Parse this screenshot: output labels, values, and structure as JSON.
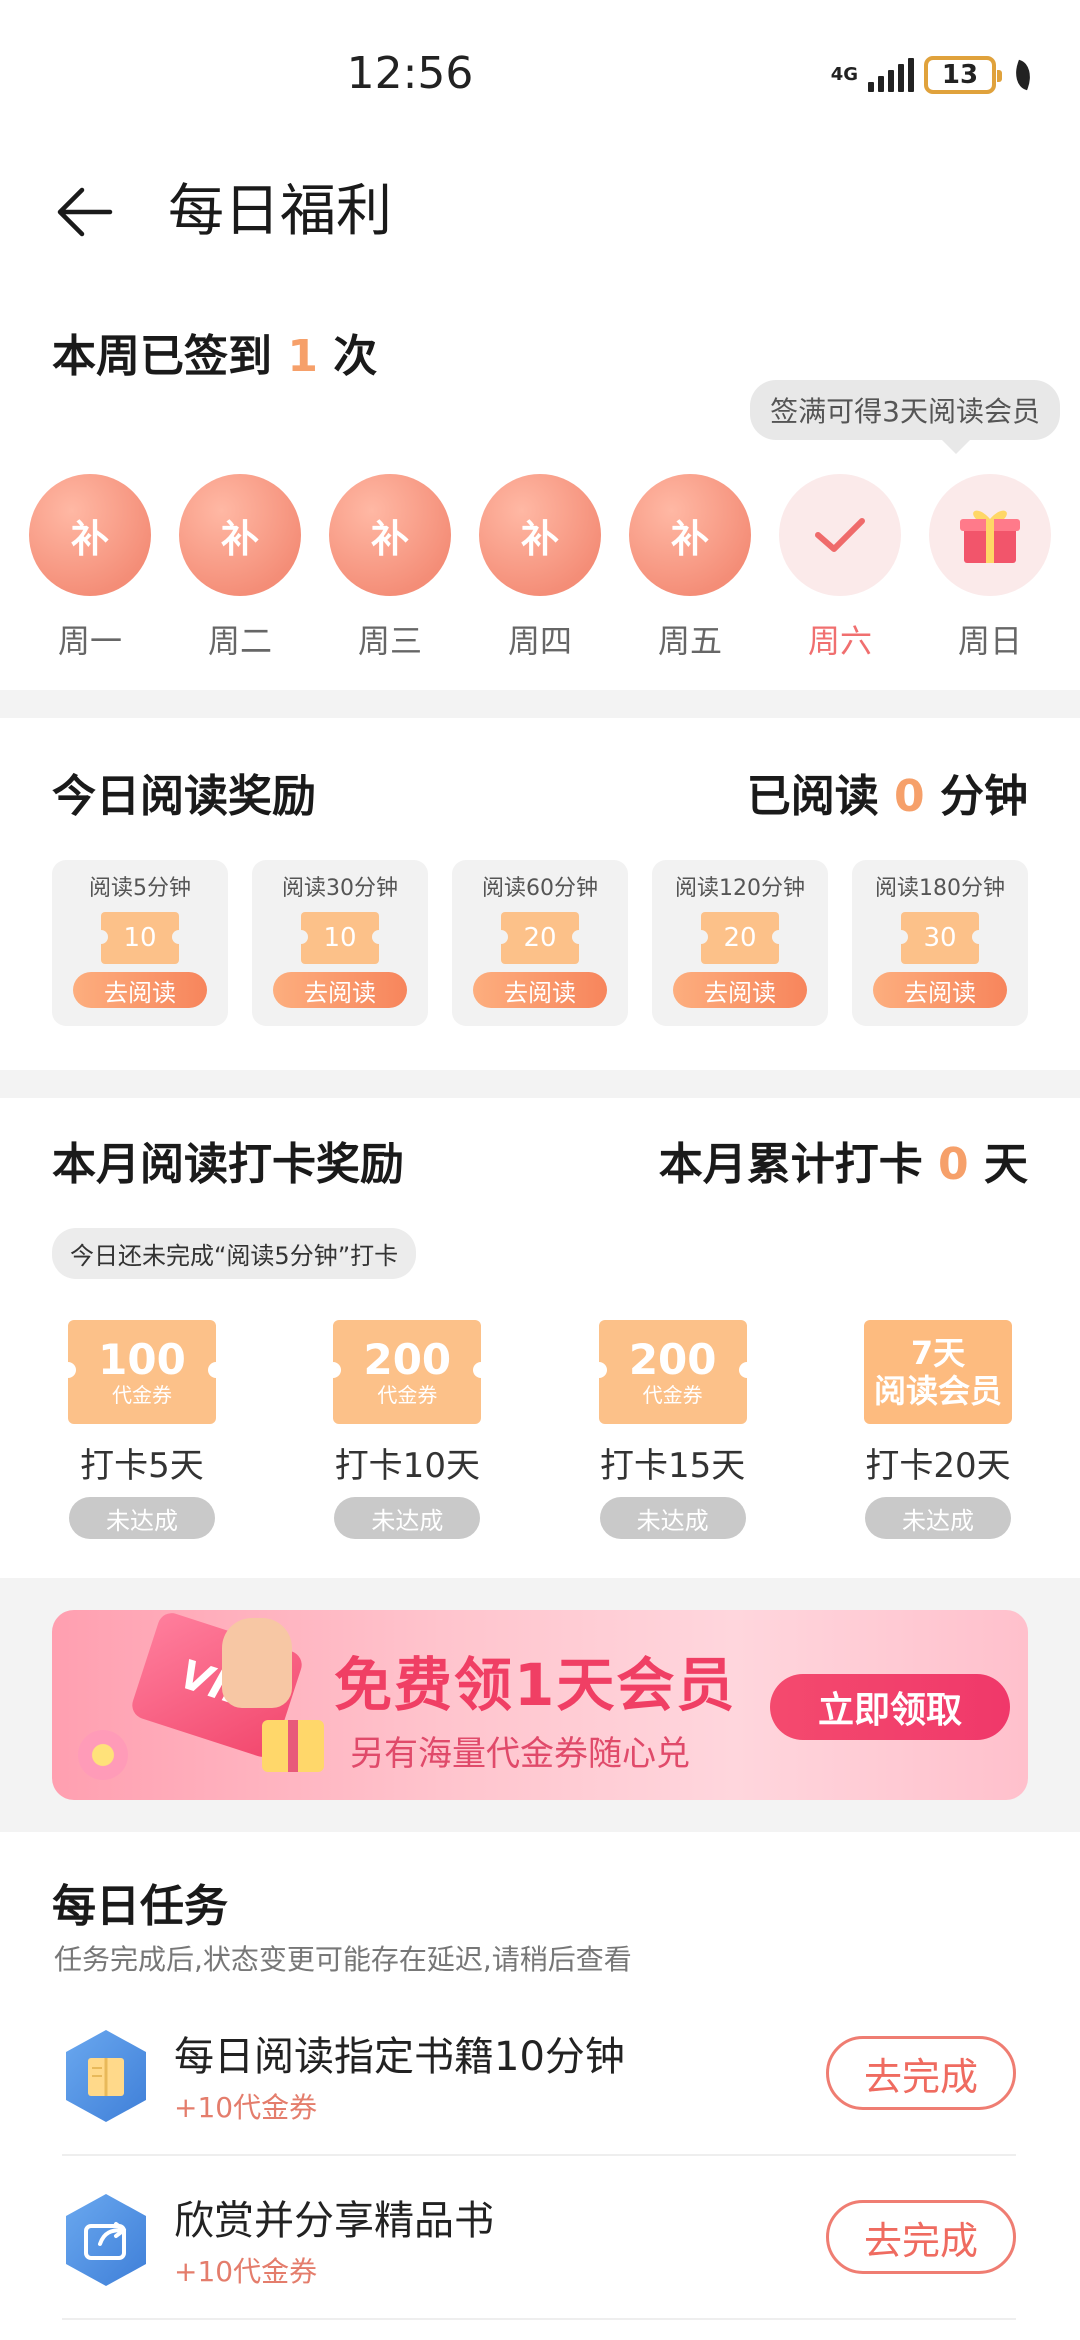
{
  "status_bar": {
    "time": "12:56",
    "network": "4G",
    "battery": "13"
  },
  "header": {
    "title": "每日福利"
  },
  "sign_in": {
    "title_prefix": "本周已签到 ",
    "count": "1",
    "title_suffix": " 次",
    "tooltip": "签满可得3天阅读会员",
    "days": [
      {
        "label": "周一",
        "badge": "补",
        "state": "makeup"
      },
      {
        "label": "周二",
        "badge": "补",
        "state": "makeup"
      },
      {
        "label": "周三",
        "badge": "补",
        "state": "makeup"
      },
      {
        "label": "周四",
        "badge": "补",
        "state": "makeup"
      },
      {
        "label": "周五",
        "badge": "补",
        "state": "makeup"
      },
      {
        "label": "周六",
        "badge": "",
        "state": "checked"
      },
      {
        "label": "周日",
        "badge": "",
        "state": "gift"
      }
    ]
  },
  "reading_reward": {
    "title": "今日阅读奖励",
    "read_prefix": "已阅读 ",
    "read_minutes": "0",
    "read_suffix": " 分钟",
    "cards": [
      {
        "label": "阅读5分钟",
        "value": "10",
        "button": "去阅读"
      },
      {
        "label": "阅读30分钟",
        "value": "10",
        "button": "去阅读"
      },
      {
        "label": "阅读60分钟",
        "value": "20",
        "button": "去阅读"
      },
      {
        "label": "阅读120分钟",
        "value": "20",
        "button": "去阅读"
      },
      {
        "label": "阅读180分钟",
        "value": "30",
        "button": "去阅读"
      }
    ]
  },
  "monthly": {
    "title": "本月阅读打卡奖励",
    "total_prefix": "本月累计打卡 ",
    "total_days": "0",
    "total_suffix": " 天",
    "hint": "今日还未完成“阅读5分钟”打卡",
    "milestones": [
      {
        "big": "100",
        "small": "代金券",
        "days": "打卡5天",
        "status": "未达成"
      },
      {
        "big": "200",
        "small": "代金券",
        "days": "打卡10天",
        "status": "未达成"
      },
      {
        "big": "200",
        "small": "代金券",
        "days": "打卡15天",
        "status": "未达成"
      },
      {
        "line1": "7天",
        "line2": "阅读会员",
        "days": "打卡20天",
        "status": "未达成"
      }
    ]
  },
  "banner": {
    "card_text": "VIP",
    "main": "免费领1天会员",
    "sub": "另有海量代金券随心兑",
    "button": "立即领取"
  },
  "tasks": {
    "title": "每日任务",
    "subtitle": "任务完成后,状态变更可能存在延迟,请稍后查看",
    "items": [
      {
        "name": "每日阅读指定书籍10分钟",
        "reward": "+10代金券",
        "button": "去完成",
        "icon": "book-icon"
      },
      {
        "name": "欣赏并分享精品书",
        "reward": "+10代金券",
        "button": "去完成",
        "icon": "share-icon"
      }
    ]
  },
  "colors": {
    "accent": "#f6a06a",
    "primary_red": "#ef6b60",
    "banner_red": "#f03f64"
  }
}
